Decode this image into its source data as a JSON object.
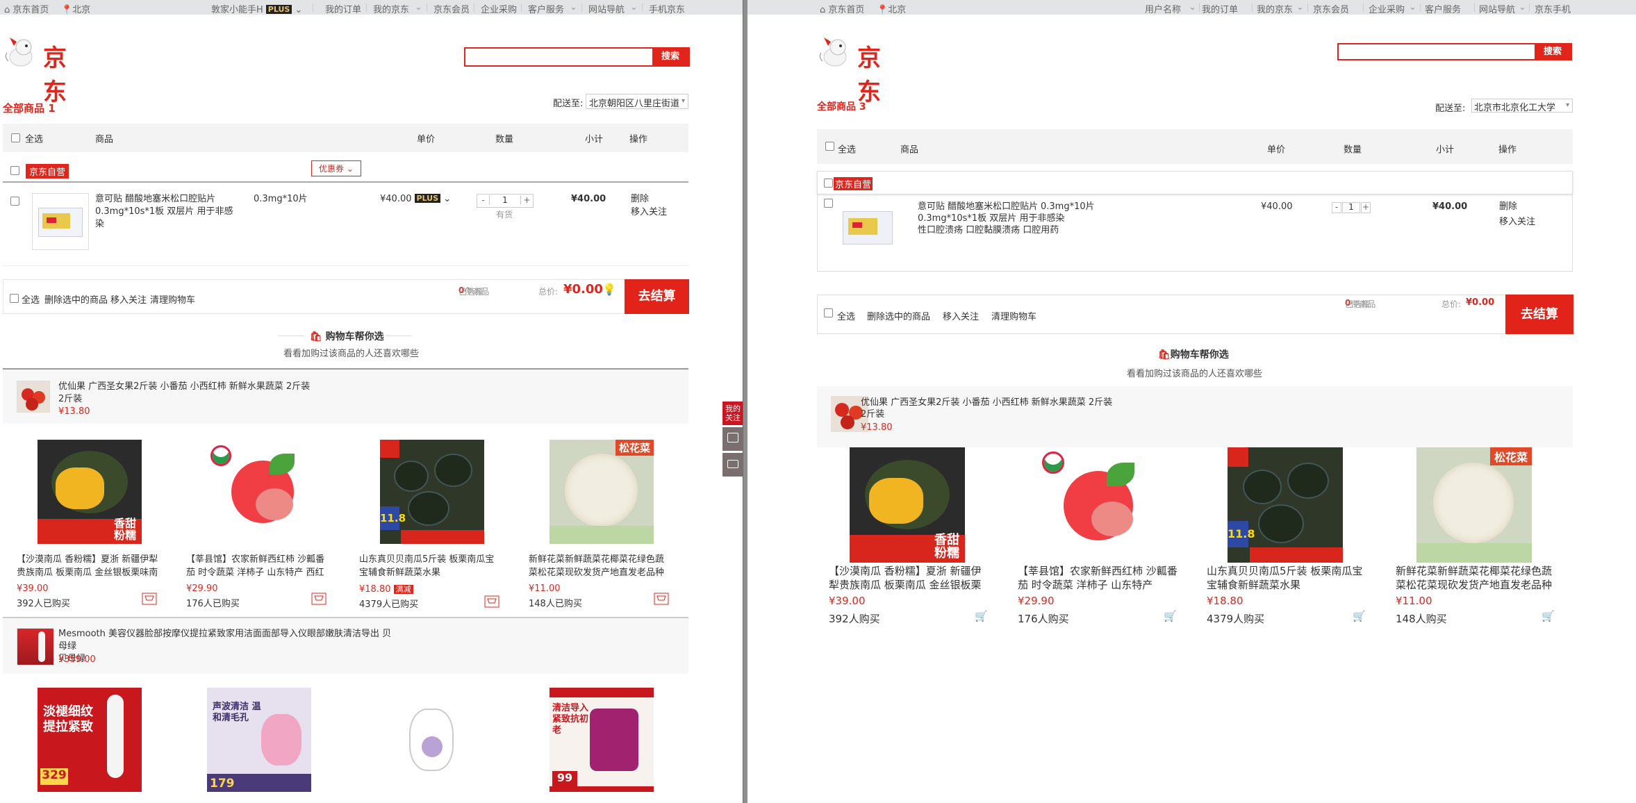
{
  "left": {
    "topbar": {
      "home": "京东首页",
      "location": "北京",
      "user": "敦家小能手H",
      "plus": "PLUS",
      "links": [
        "我的订单",
        "我的京东",
        "京东会员",
        "企业采购",
        "客户服务",
        "网站导航",
        "手机京东"
      ]
    },
    "logo_text": "京东",
    "search": {
      "button": "搜索",
      "placeholder": ""
    },
    "all_goods": "全部商品",
    "all_goods_count": "1",
    "deliver_label": "配送至:",
    "address": "北京朝阳区八里庄街道",
    "header": {
      "select_all": "全选",
      "goods": "商品",
      "unit_price": "单价",
      "quantity": "数量",
      "subtotal": "小计",
      "operation": "操作"
    },
    "shop": "京东自营",
    "coupon": "优惠券",
    "item": {
      "title": "意可贴 醋酸地塞米松口腔贴片",
      "spec_line": "0.3mg*10s*1板 双层片 用于非感染",
      "spec": "0.3mg*10片",
      "unit_price": "¥40.00",
      "plus": "PLUS",
      "qty": "1",
      "stock": "有货",
      "subtotal": "¥40.00",
      "delete": "删除",
      "move_favorite": "移入关注"
    },
    "summary": {
      "select_all": "全选",
      "delete_selected": "删除选中的商品",
      "move_favorite": "移入关注",
      "clear_cart": "清理购物车",
      "selected_prefix": "已选择",
      "selected_count": "0",
      "selected_suffix": "件商品",
      "total_label": "总价:",
      "total": "¥0.00",
      "checkout": "去结算"
    },
    "rec_title": "购物车帮你选",
    "rec_sub": "看看加购过该商品的人还喜欢哪些",
    "rec_group1": {
      "title": "优仙果 广西圣女果2斤装 小番茄 小西红柿 新鲜水果蔬菜 2斤装",
      "line2": "2斤装",
      "price": "¥13.80"
    },
    "products1": [
      {
        "name": "【沙漠南瓜 香粉糯】夏浙 新疆伊犁贵族南瓜 板栗南瓜 金丝银板栗味南瓜沙",
        "price": "¥39.00",
        "buyers": "392人已购买",
        "tag": "香甜粉糯"
      },
      {
        "name": "【莘县馆】农家新鲜西红柿 沙瓤番茄 时令蔬菜 洋柿子 山东特产 西红柿",
        "price": "¥29.90",
        "buyers": "176人已购买",
        "tag": ""
      },
      {
        "name": "山东真贝贝南瓜5斤装 板栗南瓜宝宝辅食新鲜蔬菜水果",
        "price": "¥18.80",
        "buyers": "4379人已购买",
        "tag": "满减"
      },
      {
        "name": "新鲜花菜新鲜蔬菜花椰菜花绿色蔬菜松花菜现砍发货产地直发老品种农家自种",
        "price": "¥11.00",
        "buyers": "148人已购买",
        "tag": "松花菜"
      }
    ],
    "rec_group2": {
      "title": "Mesmooth 美容仪器脸部按摩仪提拉紧致家用洁面面部导入仪眼部嫩肤清洁导出 贝母绿",
      "line2": "贝母绿",
      "price": "¥359.00"
    },
    "products2_labels": [
      "淡褪细纹 提拉紧致",
      "声波清洁 温和清毛孔",
      "",
      "清洁导入 紧致抗初老"
    ],
    "products2_prices": [
      "329",
      "179",
      "",
      "99"
    ],
    "sidebar": {
      "favorite": "我的关注"
    }
  },
  "right": {
    "topbar": {
      "home": "京东首页",
      "location": "北京",
      "links": [
        "用户名称",
        "我的订单",
        "我的京东",
        "京东会员",
        "企业采购",
        "客户服务",
        "网站导航",
        "京东手机"
      ]
    },
    "logo_text": "京东",
    "search": {
      "button": "搜索",
      "placeholder": ""
    },
    "all_goods": "全部商品",
    "all_goods_count": "3",
    "deliver_label": "配送至:",
    "address": "北京市北京化工大学",
    "header": {
      "select_all": "全选",
      "goods": "商品",
      "unit_price": "单价",
      "quantity": "数量",
      "subtotal": "小计",
      "operation": "操作"
    },
    "shop": "京东自营",
    "item": {
      "title": "意可贴 醋酸地塞米松口腔贴片",
      "line2": "0.3mg*10s*1板 双层片 用于非感染",
      "line3": "性口腔溃疡 口腔黏膜溃疡 口腔用药",
      "spec": "0.3mg*10片",
      "unit_price": "¥40.00",
      "qty": "1",
      "subtotal": "¥40.00",
      "delete": "删除",
      "move_favorite": "移入关注"
    },
    "summary": {
      "select_all": "全选",
      "delete_selected": "删除选中的商品",
      "move_favorite": "移入关注",
      "clear_cart": "清理购物车",
      "selected_prefix": "已选择",
      "selected_count": "0",
      "selected_suffix": "件商品",
      "total_label": "总价:",
      "total": "¥0.00",
      "checkout": "去结算"
    },
    "rec_title": "购物车帮你选",
    "rec_sub": "看看加购过该商品的人还喜欢哪些",
    "rec_group1": {
      "title": "优仙果 广西圣女果2斤装 小番茄 小西红柿 新鲜水果蔬菜 2斤装",
      "line2": "2斤装",
      "price": "¥13.80"
    },
    "products1": [
      {
        "name": "【沙漠南瓜 香粉糯】夏浙 新疆伊犁贵族南瓜 板栗南瓜 金丝银板栗",
        "price": "¥39.00",
        "buyers": "392人购买",
        "tag": "香甜粉糯"
      },
      {
        "name": "【莘县馆】农家新鲜西红柿 沙瓤番茄 时令蔬菜 洋柿子 山东特产",
        "price": "¥29.90",
        "buyers": "176人购买",
        "tag": ""
      },
      {
        "name": "山东真贝贝南瓜5斤装 板栗南瓜宝宝辅食新鲜蔬菜水果",
        "price": "¥18.80",
        "buyers": "4379人购买",
        "tag": ""
      },
      {
        "name": "新鲜花菜新鲜蔬菜花椰菜花绿色蔬菜松花菜现砍发货产地直发老品种",
        "price": "¥11.00",
        "buyers": "148人购买",
        "tag": "松花菜"
      }
    ]
  },
  "colors": {
    "brand_red": "#e1251b",
    "checkout_red": "#e2231a",
    "plus_black": "#222222",
    "header_gray": "#f3f3f3"
  },
  "icons": [
    "location-pin-icon",
    "home-icon",
    "cart-icon",
    "shopping-bag-icon",
    "lightbulb-icon",
    "wallet-icon"
  ]
}
